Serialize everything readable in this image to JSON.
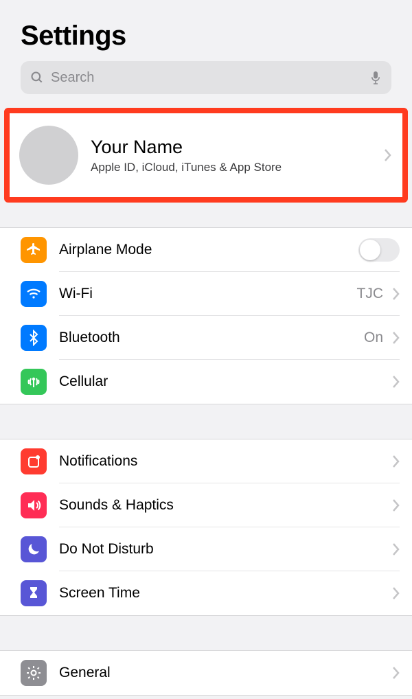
{
  "header": {
    "title": "Settings"
  },
  "search": {
    "placeholder": "Search"
  },
  "account": {
    "name": "Your Name",
    "subtitle": "Apple ID, iCloud, iTunes & App Store"
  },
  "section1": {
    "airplane": {
      "label": "Airplane Mode"
    },
    "wifi": {
      "label": "Wi-Fi",
      "value": "TJC"
    },
    "bluetooth": {
      "label": "Bluetooth",
      "value": "On"
    },
    "cellular": {
      "label": "Cellular"
    }
  },
  "section2": {
    "notifications": {
      "label": "Notifications"
    },
    "sounds": {
      "label": "Sounds & Haptics"
    },
    "dnd": {
      "label": "Do Not Disturb"
    },
    "screentime": {
      "label": "Screen Time"
    }
  },
  "section3": {
    "general": {
      "label": "General"
    }
  }
}
